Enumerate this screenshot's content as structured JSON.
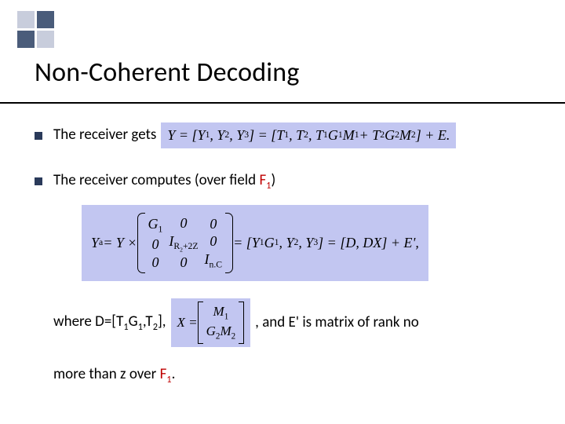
{
  "title": "Non-Coherent Decoding",
  "bullets": {
    "b1_text": "The receiver gets",
    "b2_text": "The receiver computes (over field ",
    "b2_field": "F",
    "b2_field_sub": "1",
    "b2_close": ")"
  },
  "eq1": {
    "lhs": "Y = [Y",
    "y1s": "1",
    "c1": ", Y",
    "y2s": "2",
    "c2": ", Y",
    "y3s": "3",
    "mid": "] = [T",
    "t1s": "1",
    "c3": ", T",
    "t2s": "2",
    "c4": ", T",
    "t1bs": "1",
    "g1": "G",
    "g1s": "1",
    "m1": "M",
    "m1s": "1",
    "plus": " + T",
    "t2bs": "2",
    "g2": "G",
    "g2s": "2",
    "m2": "M",
    "m2s": "2",
    "end": "] + E."
  },
  "eq2": {
    "Ya": "Y",
    "Ya_sub": "a",
    "eq": " = Y × ",
    "m": {
      "r1c1": "G",
      "r1c1s": "1",
      "r1c2": "0",
      "r1c3": "0",
      "r2c1": "0",
      "r2c2": "I",
      "r2c2s": "R",
      "r2c2s2": "2",
      "r2c2plus": "+2Z",
      "r2c3": "0",
      "r3c1": "0",
      "r3c2": "0",
      "r3c3": "I",
      "r3c3s": "n.C"
    },
    "mid": " = [Y",
    "y1s": "1",
    "g1": "G",
    "g1s": "1",
    "c1": ", Y",
    "y2s": "2",
    "c2": ", Y",
    "y3s": "3",
    "rb": "] = [D, DX] + E',"
  },
  "line3": {
    "where": "where  D=[T",
    "t1s": "1",
    "g1": "G",
    "g1s": "1",
    "c": ",T",
    "t2s": "2",
    "end": "],",
    "X": "X = ",
    "xm": {
      "r1": "M",
      "r1s": "1",
      "r2a": "G",
      "r2as": "2",
      "r2b": "M",
      "r2bs": "2"
    },
    "after": ", and E' is matrix of rank no"
  },
  "line4": {
    "text": "more than z over ",
    "F": "F",
    "Fs": "1",
    "dot": "."
  }
}
